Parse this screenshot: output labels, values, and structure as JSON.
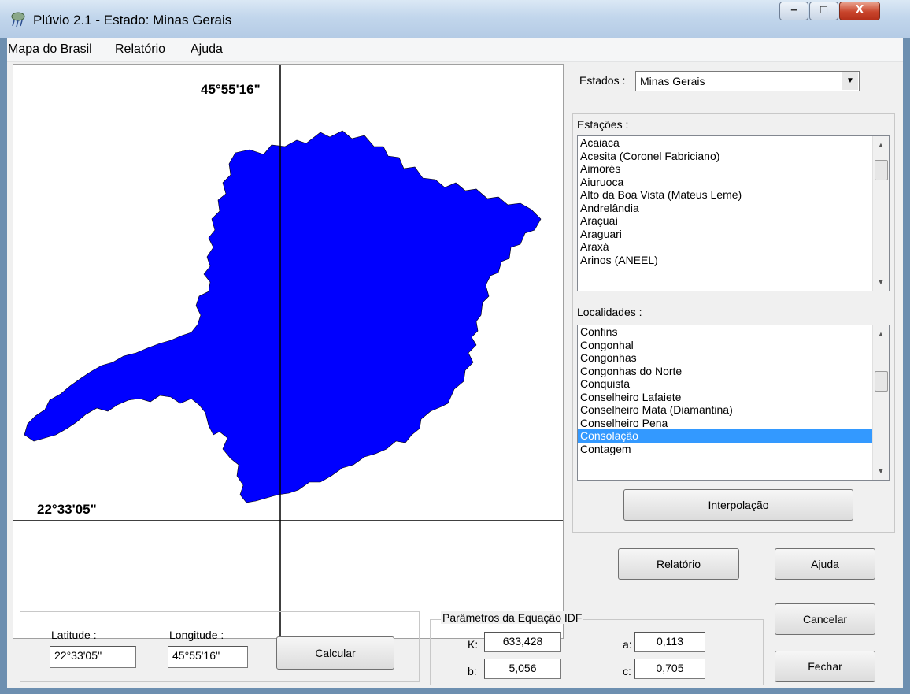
{
  "window": {
    "title": "Plúvio 2.1 - Estado: Minas Gerais",
    "controls": {
      "minimize": "–",
      "maximize": "□",
      "close": "X"
    }
  },
  "menu": [
    "Mapa do Brasil",
    "Relatório",
    "Ajuda"
  ],
  "map": {
    "longitude_label": "45°55'16\"",
    "latitude_label": "22°33'05\"",
    "fill_color": "#0000ff"
  },
  "estados": {
    "label": "Estados :",
    "value": "Minas Gerais"
  },
  "estacoes": {
    "label": "Estações :",
    "items": [
      "Acaiaca",
      "Acesita (Coronel Fabriciano)",
      "Aimorés",
      "Aiuruoca",
      "Alto da Boa Vista (Mateus Leme)",
      "Andrelândia",
      "Araçuaí",
      "Araguari",
      "Araxá",
      "Arinos (ANEEL)"
    ]
  },
  "localidades": {
    "label": "Localidades :",
    "items": [
      "Confins",
      "Congonhal",
      "Congonhas",
      "Congonhas do Norte",
      "Conquista",
      "Conselheiro Lafaiete",
      "Conselheiro Mata (Diamantina)",
      "Conselheiro Pena",
      "Consolação",
      "Contagem"
    ],
    "selected": "Consolação",
    "selection_color": "#3399ff"
  },
  "buttons": {
    "interpolacao": "Interpolação",
    "relatorio": "Relatório",
    "ajuda": "Ajuda",
    "cancelar": "Cancelar",
    "fechar": "Fechar",
    "calcular": "Calcular"
  },
  "coords": {
    "latitude_label": "Latitude :",
    "latitude_value": "22°33'05''",
    "longitude_label": "Longitude :",
    "longitude_value": "45°55'16''"
  },
  "idf": {
    "title": "Parâmetros da Equação IDF",
    "K_label": "K:",
    "K": "633,428",
    "b_label": "b:",
    "b": "5,056",
    "a_label": "a:",
    "a": "0,113",
    "c_label": "c:",
    "c": "0,705"
  }
}
